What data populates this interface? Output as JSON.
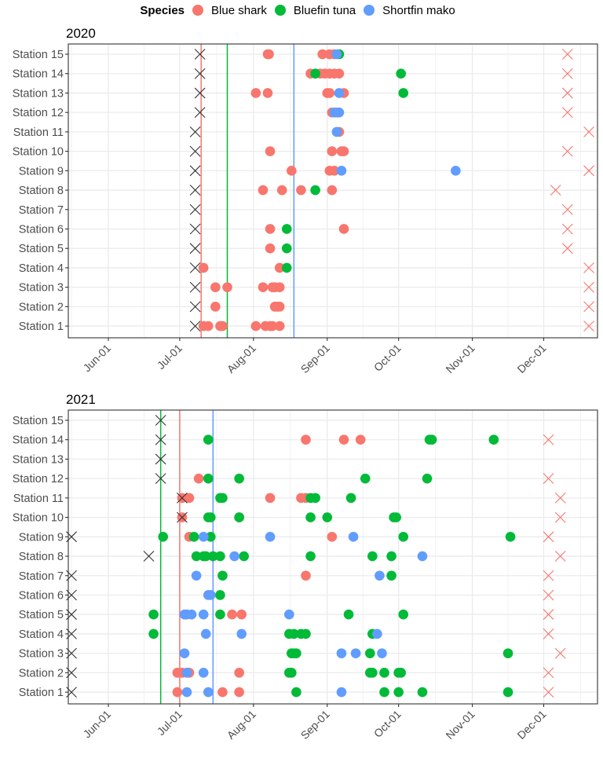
{
  "legend": {
    "title": "Species",
    "items": [
      {
        "label": "Blue shark",
        "color": "#F8766D"
      },
      {
        "label": "Bluefin tuna",
        "color": "#00BA38"
      },
      {
        "label": "Shortfin mako",
        "color": "#619CFF"
      }
    ]
  },
  "chart_data": [
    {
      "type": "scatter",
      "title": "2020",
      "xlabel": "",
      "ylabel": "",
      "x_unit": "day offset from Jun-01",
      "xlim_days": [
        -17,
        205
      ],
      "x_ticks": [
        {
          "label": "Jun-01",
          "day": 0
        },
        {
          "label": "Jul-01",
          "day": 30
        },
        {
          "label": "Aug-01",
          "day": 61
        },
        {
          "label": "Sep-01",
          "day": 92
        },
        {
          "label": "Oct-01",
          "day": 122
        },
        {
          "label": "Nov-01",
          "day": 153
        },
        {
          "label": "Dec-01",
          "day": 183
        }
      ],
      "categories": [
        "Station 1",
        "Station 2",
        "Station 3",
        "Station 4",
        "Station 5",
        "Station 6",
        "Station 7",
        "Station 8",
        "Station 9",
        "Station 10",
        "Station 11",
        "Station 12",
        "Station 13",
        "Station 14",
        "Station 15"
      ],
      "vlines": [
        {
          "species": "Blue shark",
          "day": 39
        },
        {
          "species": "Bluefin tuna",
          "day": 50
        },
        {
          "species": "Shortfin mako",
          "day": 78
        }
      ],
      "deploy": [
        {
          "station": 15,
          "day": 38.5
        },
        {
          "station": 14,
          "day": 38.5
        },
        {
          "station": 13,
          "day": 38.5
        },
        {
          "station": 12,
          "day": 38.5
        },
        {
          "station": 11,
          "day": 36.5
        },
        {
          "station": 10,
          "day": 36.5
        },
        {
          "station": 9,
          "day": 36.5
        },
        {
          "station": 8,
          "day": 36.5
        },
        {
          "station": 7,
          "day": 36.5
        },
        {
          "station": 6,
          "day": 36.5
        },
        {
          "station": 5,
          "day": 36.5
        },
        {
          "station": 4,
          "day": 36.5
        },
        {
          "station": 3,
          "day": 36.5
        },
        {
          "station": 2,
          "day": 36.5
        },
        {
          "station": 1,
          "day": 36.5
        }
      ],
      "retrieve": [
        {
          "station": 15,
          "day": 193
        },
        {
          "station": 14,
          "day": 193
        },
        {
          "station": 13,
          "day": 193
        },
        {
          "station": 12,
          "day": 193
        },
        {
          "station": 11,
          "day": 202
        },
        {
          "station": 10,
          "day": 193
        },
        {
          "station": 9,
          "day": 202
        },
        {
          "station": 8,
          "day": 188
        },
        {
          "station": 7,
          "day": 193
        },
        {
          "station": 6,
          "day": 193
        },
        {
          "station": 5,
          "day": 193
        },
        {
          "station": 4,
          "day": 202
        },
        {
          "station": 3,
          "day": 202
        },
        {
          "station": 2,
          "day": 202
        },
        {
          "station": 1,
          "day": 202
        }
      ],
      "series": [
        {
          "name": "Blue shark",
          "points": [
            [
              15,
              67
            ],
            [
              15,
              67.5
            ],
            [
              15,
              90
            ],
            [
              15,
              93
            ],
            [
              15,
              95
            ],
            [
              14,
              85
            ],
            [
              14,
              89
            ],
            [
              14,
              91
            ],
            [
              14,
              93
            ],
            [
              14,
              95
            ],
            [
              14,
              97
            ],
            [
              13,
              62
            ],
            [
              13,
              67
            ],
            [
              13,
              92
            ],
            [
              13,
              93
            ],
            [
              13,
              99
            ],
            [
              12,
              94
            ],
            [
              11,
              97
            ],
            [
              10,
              68
            ],
            [
              10,
              94
            ],
            [
              10,
              98
            ],
            [
              10,
              99
            ],
            [
              9,
              77
            ],
            [
              9,
              93
            ],
            [
              9,
              95
            ],
            [
              8,
              65
            ],
            [
              8,
              73
            ],
            [
              8,
              81
            ],
            [
              8,
              94
            ],
            [
              6,
              68
            ],
            [
              6,
              99
            ],
            [
              5,
              68
            ],
            [
              4,
              40
            ],
            [
              4,
              72
            ],
            [
              3,
              45
            ],
            [
              3,
              50
            ],
            [
              3,
              65
            ],
            [
              3,
              69
            ],
            [
              3,
              70
            ],
            [
              3,
              72
            ],
            [
              2,
              45
            ],
            [
              2,
              70
            ],
            [
              2,
              71
            ],
            [
              2,
              72
            ],
            [
              1,
              40
            ],
            [
              1,
              42
            ],
            [
              1,
              47
            ],
            [
              1,
              48
            ],
            [
              1,
              62
            ],
            [
              1,
              66
            ],
            [
              1,
              68
            ],
            [
              1,
              69
            ],
            [
              1,
              72
            ]
          ]
        },
        {
          "name": "Bluefin tuna",
          "points": [
            [
              15,
              97
            ],
            [
              14,
              87
            ],
            [
              14,
              123
            ],
            [
              13,
              124
            ],
            [
              8,
              87
            ],
            [
              6,
              75
            ],
            [
              5,
              75
            ],
            [
              4,
              75
            ]
          ]
        },
        {
          "name": "Shortfin mako",
          "points": [
            [
              15,
              96
            ],
            [
              13,
              97
            ],
            [
              12,
              95
            ],
            [
              12,
              96
            ],
            [
              12,
              97
            ],
            [
              11,
              96
            ],
            [
              9,
              98
            ],
            [
              9,
              146
            ]
          ]
        }
      ]
    },
    {
      "type": "scatter",
      "title": "2021",
      "xlabel": "",
      "ylabel": "",
      "x_unit": "day offset from Jun-01",
      "xlim_days": [
        -17,
        205
      ],
      "x_ticks": [
        {
          "label": "Jun-01",
          "day": 0
        },
        {
          "label": "Jul-01",
          "day": 30
        },
        {
          "label": "Aug-01",
          "day": 61
        },
        {
          "label": "Sep-01",
          "day": 92
        },
        {
          "label": "Oct-01",
          "day": 122
        },
        {
          "label": "Nov-01",
          "day": 153
        },
        {
          "label": "Dec-01",
          "day": 183
        }
      ],
      "categories": [
        "Station 1",
        "Station 2",
        "Station 3",
        "Station 4",
        "Station 5",
        "Station 6",
        "Station 7",
        "Station 8",
        "Station 9",
        "Station 10",
        "Station 11",
        "Station 12",
        "Station 13",
        "Station 14",
        "Station 15"
      ],
      "vlines": [
        {
          "species": "Bluefin tuna",
          "day": 22
        },
        {
          "species": "Blue shark",
          "day": 30
        },
        {
          "species": "Shortfin mako",
          "day": 44
        }
      ],
      "deploy": [
        {
          "station": 15,
          "day": 22
        },
        {
          "station": 14,
          "day": 22
        },
        {
          "station": 13,
          "day": 22
        },
        {
          "station": 12,
          "day": 22
        },
        {
          "station": 11,
          "day": 31
        },
        {
          "station": 10,
          "day": 31
        },
        {
          "station": 9,
          "day": -15.5
        },
        {
          "station": 8,
          "day": 17
        },
        {
          "station": 7,
          "day": -15.5
        },
        {
          "station": 6,
          "day": -15.5
        },
        {
          "station": 5,
          "day": -15.5
        },
        {
          "station": 4,
          "day": -15.5
        },
        {
          "station": 3,
          "day": -15.5
        },
        {
          "station": 2,
          "day": -15.5
        },
        {
          "station": 1,
          "day": -15.5
        }
      ],
      "retrieve": [
        {
          "station": 14,
          "day": 185
        },
        {
          "station": 12,
          "day": 185
        },
        {
          "station": 11,
          "day": 190
        },
        {
          "station": 10,
          "day": 190
        },
        {
          "station": 9,
          "day": 185
        },
        {
          "station": 8,
          "day": 190
        },
        {
          "station": 7,
          "day": 185
        },
        {
          "station": 6,
          "day": 185
        },
        {
          "station": 5,
          "day": 185
        },
        {
          "station": 4,
          "day": 185
        },
        {
          "station": 3,
          "day": 190
        },
        {
          "station": 2,
          "day": 185
        },
        {
          "station": 1,
          "day": 185
        }
      ],
      "series": [
        {
          "name": "Blue shark",
          "points": [
            [
              14,
              83
            ],
            [
              14,
              99
            ],
            [
              14,
              106
            ],
            [
              12,
              38
            ],
            [
              11,
              31
            ],
            [
              11,
              34
            ],
            [
              11,
              68
            ],
            [
              11,
              81
            ],
            [
              11,
              83
            ],
            [
              10,
              31
            ],
            [
              10,
              55
            ],
            [
              9,
              34
            ],
            [
              9,
              94
            ],
            [
              7,
              83
            ],
            [
              5,
              52
            ],
            [
              5,
              56
            ],
            [
              2,
              29
            ],
            [
              2,
              31
            ],
            [
              2,
              34
            ],
            [
              2,
              55
            ],
            [
              1,
              29
            ],
            [
              1,
              48
            ],
            [
              1,
              55
            ]
          ]
        },
        {
          "name": "Bluefin tuna",
          "points": [
            [
              14,
              42
            ],
            [
              14,
              135
            ],
            [
              14,
              136
            ],
            [
              14,
              162
            ],
            [
              12,
              42
            ],
            [
              12,
              55
            ],
            [
              12,
              108
            ],
            [
              12,
              134
            ],
            [
              11,
              47
            ],
            [
              11,
              48
            ],
            [
              11,
              85
            ],
            [
              11,
              87
            ],
            [
              11,
              102
            ],
            [
              10,
              42
            ],
            [
              10,
              43
            ],
            [
              10,
              55
            ],
            [
              10,
              85
            ],
            [
              10,
              92
            ],
            [
              10,
              120
            ],
            [
              10,
              121
            ],
            [
              9,
              23
            ],
            [
              9,
              36
            ],
            [
              9,
              43
            ],
            [
              9,
              124
            ],
            [
              9,
              169
            ],
            [
              8,
              37
            ],
            [
              8,
              40
            ],
            [
              8,
              41
            ],
            [
              8,
              44
            ],
            [
              8,
              47
            ],
            [
              8,
              57
            ],
            [
              8,
              85
            ],
            [
              8,
              111
            ],
            [
              8,
              119
            ],
            [
              7,
              48
            ],
            [
              7,
              119
            ],
            [
              6,
              47
            ],
            [
              5,
              19
            ],
            [
              5,
              47
            ],
            [
              5,
              101
            ],
            [
              5,
              124
            ],
            [
              4,
              19
            ],
            [
              4,
              76
            ],
            [
              4,
              78
            ],
            [
              4,
              81
            ],
            [
              4,
              83
            ],
            [
              4,
              111
            ],
            [
              3,
              77
            ],
            [
              3,
              78
            ],
            [
              3,
              79
            ],
            [
              3,
              110
            ],
            [
              3,
              168
            ],
            [
              2,
              76
            ],
            [
              2,
              77
            ],
            [
              2,
              110
            ],
            [
              2,
              111
            ],
            [
              2,
              116
            ],
            [
              2,
              122
            ],
            [
              2,
              123
            ],
            [
              1,
              79
            ],
            [
              1,
              116
            ],
            [
              1,
              122
            ],
            [
              1,
              132
            ],
            [
              1,
              168
            ]
          ]
        },
        {
          "name": "Shortfin mako",
          "points": [
            [
              9,
              40
            ],
            [
              9,
              68
            ],
            [
              9,
              103
            ],
            [
              8,
              53
            ],
            [
              8,
              132
            ],
            [
              7,
              37
            ],
            [
              7,
              114
            ],
            [
              6,
              42
            ],
            [
              6,
              43
            ],
            [
              5,
              32
            ],
            [
              5,
              33
            ],
            [
              5,
              35
            ],
            [
              5,
              40
            ],
            [
              5,
              76
            ],
            [
              4,
              41
            ],
            [
              4,
              56
            ],
            [
              4,
              113
            ],
            [
              3,
              32
            ],
            [
              3,
              98
            ],
            [
              3,
              104
            ],
            [
              3,
              115
            ],
            [
              2,
              33
            ],
            [
              2,
              40
            ],
            [
              1,
              33
            ],
            [
              1,
              42
            ],
            [
              1,
              98
            ]
          ]
        }
      ]
    }
  ]
}
